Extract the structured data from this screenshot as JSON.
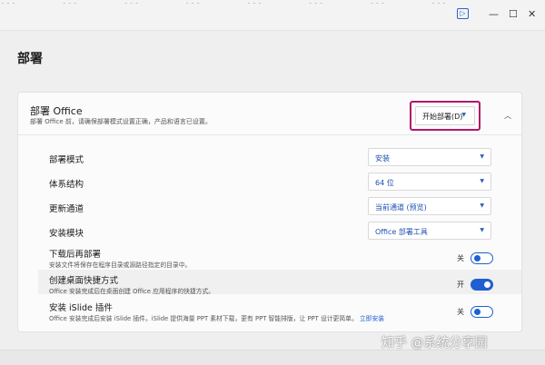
{
  "topbar": {
    "stray_text": "…  …  …  …  …  …  …  …  …  …  …",
    "toggle_glyph": "▷",
    "minimize_glyph": "—",
    "maximize_glyph": "☐",
    "close_glyph": "✕"
  },
  "page": {
    "title": "部署"
  },
  "panel": {
    "title": "部署 Office",
    "subtitle": "部署 Office 前，请确保部署模式设置正确，产品和语言已设置。",
    "deploy_button": "开始部署(D)",
    "collapse_glyph": "︿"
  },
  "settings": [
    {
      "label": "部署模式",
      "value": "安装"
    },
    {
      "label": "体系结构",
      "value": "64 位"
    },
    {
      "label": "更新通道",
      "value": "当前通道 (预览)"
    },
    {
      "label": "安装模块",
      "value": "Office 部署工具"
    }
  ],
  "toggles": [
    {
      "label": "下载后再部署",
      "desc": "安装文件将保存在程序目录或源路径指定的目录中。",
      "state_text": "关",
      "state": "off"
    },
    {
      "label": "创建桌面快捷方式",
      "desc": "Office 安装完成后在桌面创建 Office 应用程序的快捷方式。",
      "state_text": "开",
      "state": "on"
    },
    {
      "label": "安装 iSlide 插件",
      "desc": "Office 安装完成后安装 iSlide 插件。iSlide 提供海量 PPT 素材下载，更有 PPT 智能排版，让 PPT 设计更简单。",
      "desc_link": "立即安装",
      "state_text": "关",
      "state": "off"
    }
  ],
  "watermark": "知乎 @系统分享园",
  "colors": {
    "accent": "#1f5fd0",
    "highlight_border": "#b0186a",
    "background": "#efefef",
    "panel": "#fbfbfb"
  },
  "icons": {
    "caret": "chevron-down-icon",
    "collapse": "chevron-up-icon"
  }
}
